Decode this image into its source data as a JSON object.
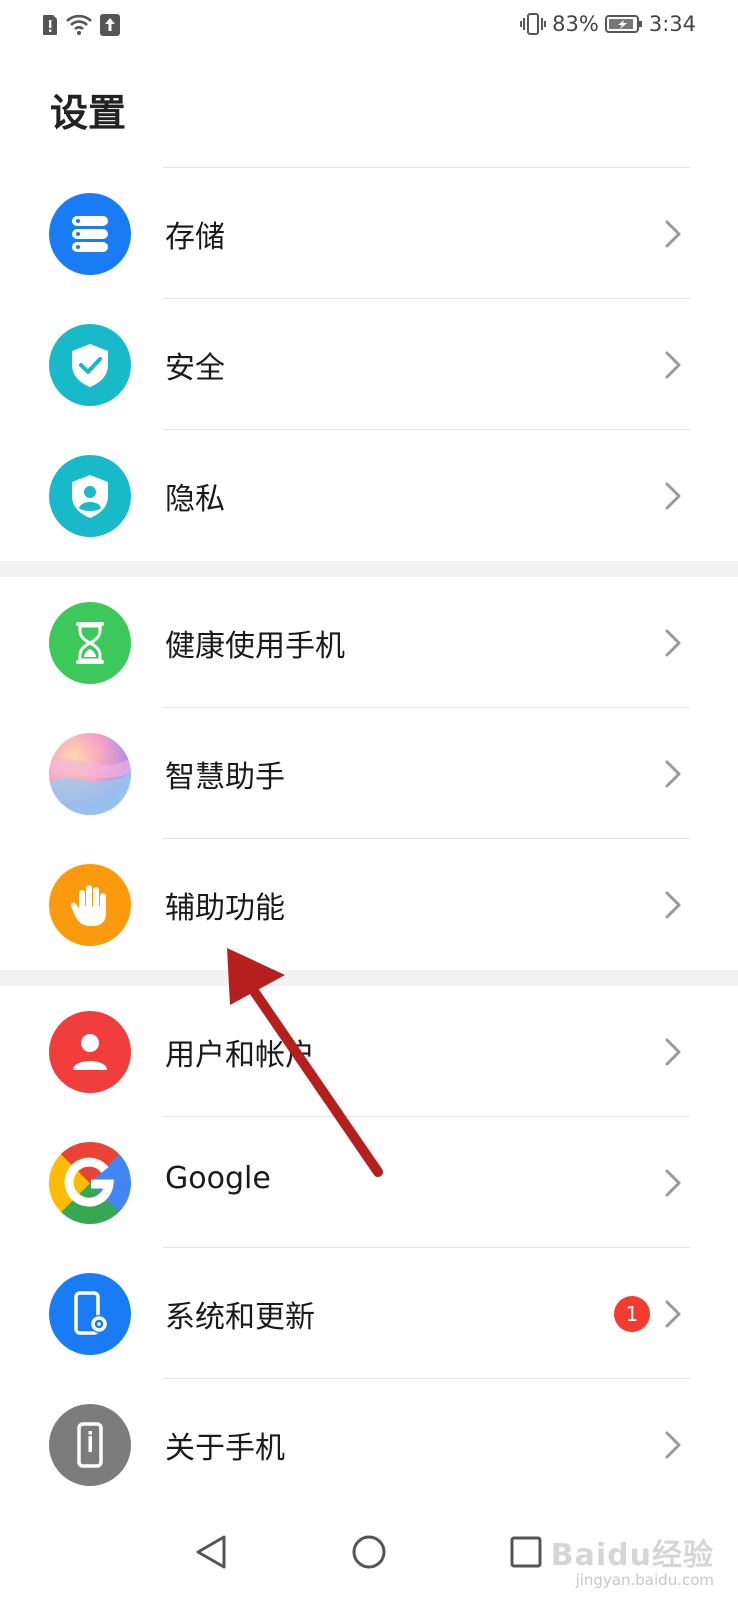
{
  "status_bar": {
    "battery": "83%",
    "time": "3:34"
  },
  "page": {
    "title": "设置"
  },
  "groups": [
    {
      "items": [
        {
          "label": "存储",
          "icon": "storage-icon",
          "color": "#1a7cf5"
        },
        {
          "label": "安全",
          "icon": "shield-check-icon",
          "color": "#18b9c9"
        },
        {
          "label": "隐私",
          "icon": "privacy-shield-icon",
          "color": "#18b9c9"
        }
      ]
    },
    {
      "items": [
        {
          "label": "健康使用手机",
          "icon": "hourglass-icon",
          "color": "#3dc85b"
        },
        {
          "label": "智慧助手",
          "icon": "assistant-orb-icon",
          "color": "#b98ee8"
        },
        {
          "label": "辅助功能",
          "icon": "hand-icon",
          "color": "#fb9a0c"
        }
      ]
    },
    {
      "items": [
        {
          "label": "用户和帐户",
          "icon": "user-icon",
          "color": "#f23d3d"
        },
        {
          "label": "Google",
          "icon": "google-icon",
          "color": "#4285f4"
        },
        {
          "label": "系统和更新",
          "icon": "phone-settings-icon",
          "color": "#1a7cf5",
          "badge": "1"
        },
        {
          "label": "关于手机",
          "icon": "phone-info-icon",
          "color": "#7c7c7c"
        }
      ]
    }
  ],
  "watermark": {
    "brand": "Baidu经验",
    "url": "jingyan.baidu.com"
  },
  "annotation_arrow_color": "#b5201e"
}
